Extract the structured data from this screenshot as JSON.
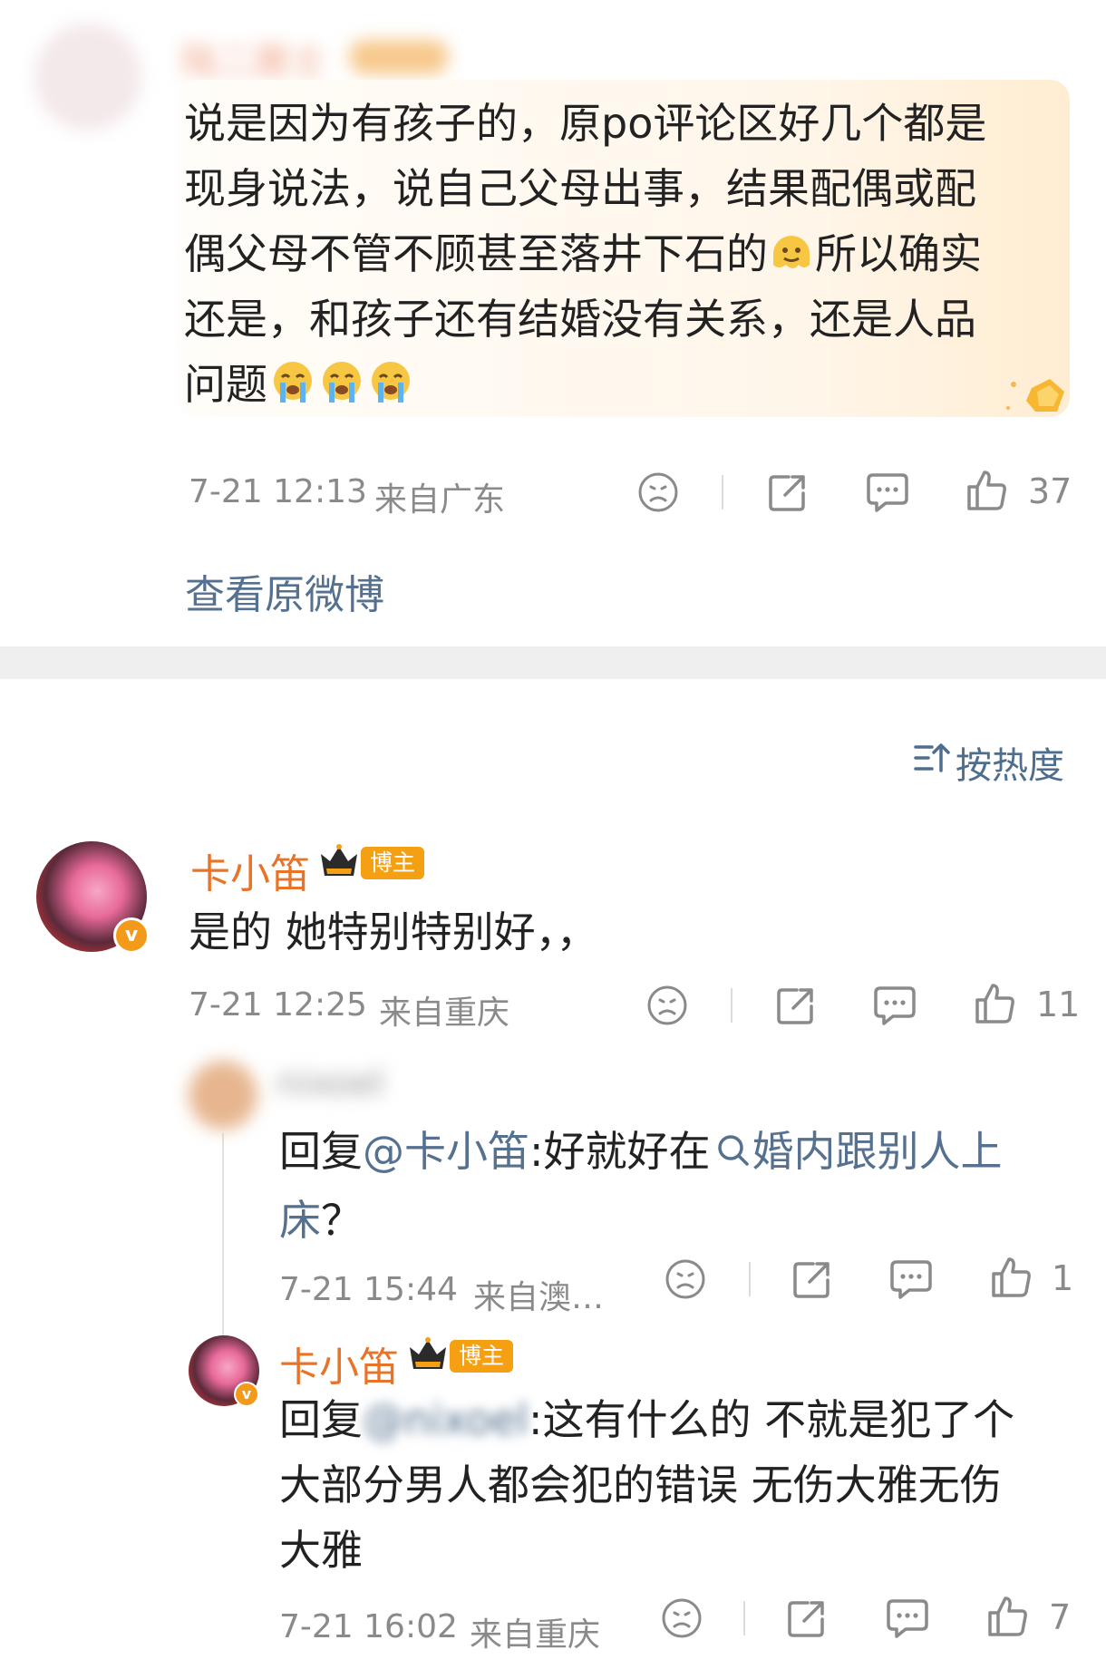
{
  "top_comment": {
    "username": "陆二居士",
    "text": "说是因为有孩子的，原po评论区好几个都是现身说法，说自己父母出事，结果配偶或配偶父母不管不顾甚至落井下石的🫠所以确实还是，和孩子还有结婚没有关系，还是人品问题😭😭😭",
    "line1": "说是因为有孩子的，原po评论区好几个都是",
    "line2": "现身说法，说自己父母出事，结果配偶或配",
    "line3a": "偶父母不管不顾甚至落井下石的",
    "line3b": "所以确实",
    "line4": "还是，和孩子还有结婚没有关系，还是人品",
    "line5": "问题",
    "timestamp": "7-21 12:13",
    "location": "来自广东",
    "like_count": "37",
    "view_original": "查看原微博"
  },
  "sort": {
    "label": "按热度"
  },
  "comment1": {
    "username": "卡小笛",
    "badge": "博主",
    "text": "是的 她特别特别好，，",
    "timestamp": "7-21 12:25",
    "location": "来自重庆",
    "like_count": "11"
  },
  "reply1": {
    "username": "nixoel",
    "prefix": "回复",
    "mention": "@卡小笛",
    "colon_text": ":好就好在",
    "topic_line1": "婚内跟别人上",
    "topic_line2": "床",
    "tail": "？",
    "timestamp": "7-21 15:44",
    "location": "来自澳…",
    "like_count": "1"
  },
  "reply2": {
    "username": "卡小笛",
    "badge": "博主",
    "prefix": "回复",
    "mention": "@nixoel",
    "line1_text": ":这有什么的 不就是犯了个",
    "line2": "大部分男人都会犯的错误 无伤大雅无伤",
    "line3": "大雅",
    "timestamp": "7-21 16:02",
    "location": "来自重庆",
    "like_count": "7"
  },
  "colors": {
    "accent_orange": "#e8742a",
    "link_blue": "#55718f",
    "badge_gold": "#f4a012"
  }
}
